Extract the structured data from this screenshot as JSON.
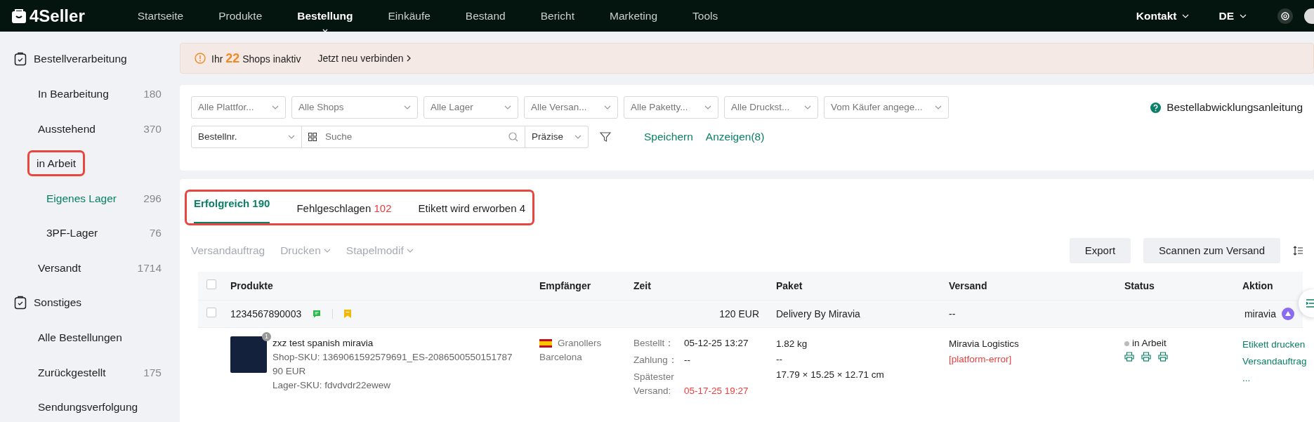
{
  "topbar": {
    "logo": "4Seller",
    "nav": [
      {
        "label": "Startseite",
        "selected": false
      },
      {
        "label": "Produkte",
        "selected": false
      },
      {
        "label": "Bestellung",
        "selected": true
      },
      {
        "label": "Einkäufe",
        "selected": false
      },
      {
        "label": "Bestand",
        "selected": false
      },
      {
        "label": "Bericht",
        "selected": false
      },
      {
        "label": "Marketing",
        "selected": false
      },
      {
        "label": "Tools",
        "selected": false
      }
    ],
    "contact": "Kontakt",
    "language": "DE"
  },
  "sidebar": {
    "groups": [
      {
        "title": "Bestellverarbeitung",
        "items": [
          {
            "label": "In Bearbeitung",
            "count": "180",
            "selected": false,
            "highlighted": false
          },
          {
            "label": "Ausstehend",
            "count": "370",
            "selected": false,
            "highlighted": false
          },
          {
            "label": "in Arbeit",
            "selected": false,
            "highlighted": true,
            "children": [
              {
                "label": "Eigenes Lager",
                "count": "296",
                "selected": true,
                "highlighted": false
              },
              {
                "label": "3PF-Lager",
                "count": "76",
                "selected": false,
                "highlighted": false
              }
            ]
          },
          {
            "label": "Versandt",
            "count": "1714",
            "selected": false,
            "highlighted": false
          }
        ]
      },
      {
        "title": "Sonstiges",
        "items": [
          {
            "label": "Alle Bestellungen",
            "selected": false,
            "highlighted": false
          },
          {
            "label": "Zurückgestellt",
            "count": "175",
            "selected": false,
            "highlighted": false
          },
          {
            "label": "Sendungsverfolgung",
            "selected": false,
            "highlighted": false
          }
        ]
      }
    ]
  },
  "banner": {
    "prefix": "Ihr",
    "count": "22",
    "suffix": "Shops inaktiv",
    "link": "Jetzt neu verbinden"
  },
  "filters": {
    "dropdowns": [
      "Alle Plattfor...",
      "Alle Shops",
      "Alle Lager",
      "Alle Versan...",
      "Alle Paketty...",
      "Alle Druckst...",
      "Vom Käufer angege..."
    ],
    "guide": "Bestellabwicklungsanleitung",
    "search_type": "Bestellnr.",
    "search": {
      "placeholder": "Suche"
    },
    "match": "Präzise",
    "save": "Speichern",
    "show": "Anzeigen(8)"
  },
  "tabs": {
    "highlighted": true,
    "items": [
      {
        "label": "Erfolgreich",
        "count": "190",
        "selected": true,
        "alert": false
      },
      {
        "label": "Fehlgeschlagen",
        "count": "102",
        "selected": false,
        "alert": true
      },
      {
        "label": "Etikett wird erworben",
        "count": "4",
        "selected": false,
        "alert": false
      }
    ]
  },
  "toolbar": {
    "actions": [
      {
        "label": "Versandauftrag",
        "dropdown": false,
        "disabled": true
      },
      {
        "label": "Drucken",
        "dropdown": true,
        "disabled": true
      },
      {
        "label": "Stapelmodif",
        "dropdown": true,
        "disabled": true
      }
    ],
    "buttons": [
      "Export",
      "Scannen zum Versand"
    ]
  },
  "table": {
    "select_all_checked": false,
    "columns": [
      "Produkte",
      "Empfänger",
      "Zeit",
      "Paket",
      "Versand",
      "Status",
      "Aktion"
    ],
    "orders": [
      {
        "order_no": "1234567890003",
        "total": "120 EUR",
        "shipping_method": "Delivery By Miravia",
        "carrier_note": "--",
        "platform": "miravia",
        "checked": false,
        "items": [
          {
            "quantity": "1",
            "title": "zxz test spanish miravia",
            "shop_sku": "Shop-SKU: 1369061592579691_ES-2086500550151787",
            "price": "90 EUR",
            "stock_sku": "Lager-SKU: fdvdvdr22ewew",
            "city": "Granollers",
            "region": "Barcelona",
            "times": [
              {
                "label": "Bestellt：",
                "value": "05-12-25 13:27",
                "late": false
              },
              {
                "label": "Zahlung：",
                "value": "--",
                "late": false
              },
              {
                "label": "Spätester Versand:",
                "value": "05-17-25 19:27",
                "late": true
              }
            ],
            "weight": "1.82 kg",
            "package_line": "--",
            "dimensions": "17.79 × 15.25 × 12.71 cm",
            "carrier": "Miravia Logistics",
            "carrier_error": "[platform-error]",
            "status": "in Arbeit",
            "actions": [
              "Etikett drucken",
              "Versandauftrag",
              "..."
            ]
          }
        ]
      }
    ]
  }
}
